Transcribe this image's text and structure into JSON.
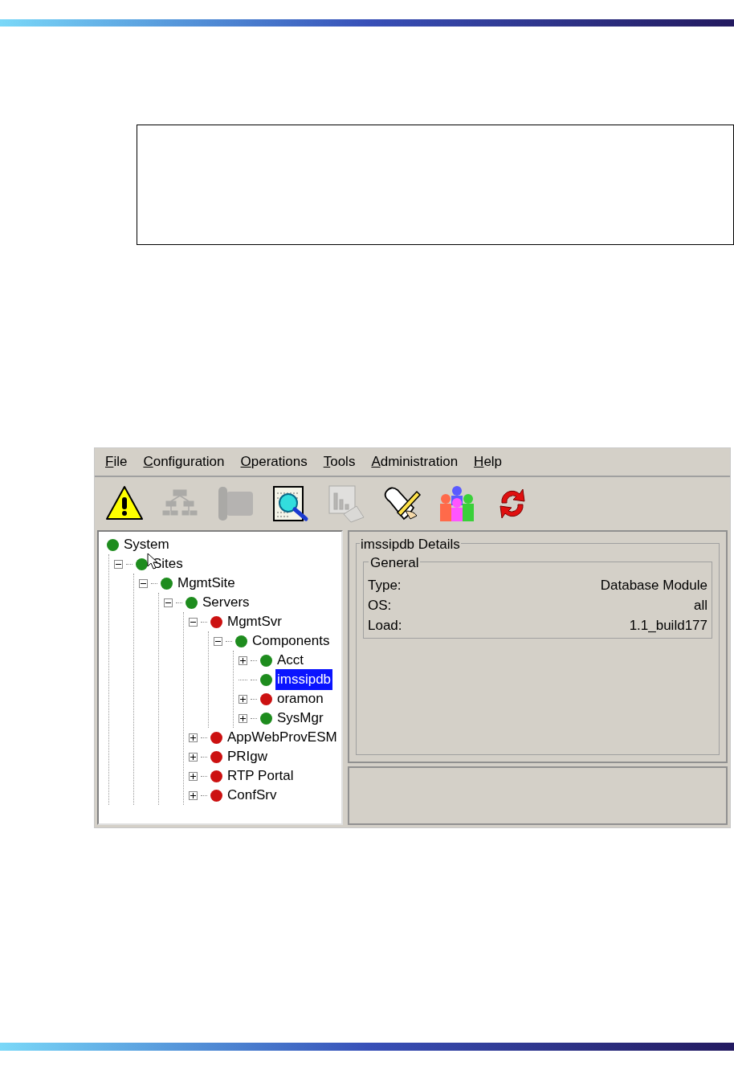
{
  "menu": [
    {
      "label": "File"
    },
    {
      "label": "Configuration"
    },
    {
      "label": "Operations"
    },
    {
      "label": "Tools"
    },
    {
      "label": "Administration"
    },
    {
      "label": "Help"
    }
  ],
  "toolbar": [
    {
      "kind": "alarm",
      "disabled": false
    },
    {
      "kind": "network",
      "disabled": true
    },
    {
      "kind": "phone",
      "disabled": true
    },
    {
      "kind": "inspect",
      "disabled": false
    },
    {
      "kind": "report",
      "disabled": true
    },
    {
      "kind": "script",
      "disabled": false
    },
    {
      "kind": "users",
      "disabled": false
    },
    {
      "kind": "refresh",
      "disabled": false
    }
  ],
  "tree": [
    {
      "label": "System",
      "kind": "root",
      "color": "#1e8c1e",
      "selected": false,
      "children": [
        {
          "label": "Sites",
          "kind": "branch",
          "expanded": true,
          "color": "#1e8c1e",
          "selected": false,
          "children": [
            {
              "label": "MgmtSite",
              "kind": "branch",
              "expanded": true,
              "color": "#1e8c1e",
              "selected": false,
              "children": [
                {
                  "label": "Servers",
                  "kind": "branch",
                  "expanded": true,
                  "color": "#1e8c1e",
                  "selected": false,
                  "children": [
                    {
                      "label": "MgmtSvr",
                      "kind": "branch",
                      "expanded": true,
                      "color": "#cc1111",
                      "selected": false,
                      "children": [
                        {
                          "label": "Components",
                          "kind": "branch",
                          "expanded": true,
                          "color": "#1e8c1e",
                          "selected": false,
                          "children": [
                            {
                              "label": "Acct",
                              "kind": "branch",
                              "expanded": false,
                              "color": "#1e8c1e",
                              "selected": false
                            },
                            {
                              "label": "imssipdb",
                              "kind": "leaf",
                              "color": "#1e8c1e",
                              "selected": true
                            },
                            {
                              "label": "oramon",
                              "kind": "branch",
                              "expanded": false,
                              "color": "#cc1111",
                              "selected": false
                            },
                            {
                              "label": "SysMgr",
                              "kind": "branch",
                              "expanded": false,
                              "color": "#1e8c1e",
                              "selected": false
                            }
                          ]
                        }
                      ]
                    },
                    {
                      "label": "AppWebProvESM",
                      "kind": "branch",
                      "expanded": false,
                      "color": "#cc1111",
                      "selected": false
                    },
                    {
                      "label": "PRIgw",
                      "kind": "branch",
                      "expanded": false,
                      "color": "#cc1111",
                      "selected": false
                    },
                    {
                      "label": "RTP Portal",
                      "kind": "branch",
                      "expanded": false,
                      "color": "#cc1111",
                      "selected": false
                    },
                    {
                      "label": "ConfSrv",
                      "kind": "branch",
                      "expanded": false,
                      "color": "#cc1111",
                      "selected": false
                    }
                  ]
                }
              ]
            }
          ]
        }
      ]
    }
  ],
  "details": {
    "title": "imssipdb Details",
    "group": "General",
    "fields": [
      {
        "label": "Type:",
        "value": "Database Module"
      },
      {
        "label": "OS:",
        "value": "all"
      },
      {
        "label": "Load:",
        "value": "1.1_build177"
      }
    ]
  }
}
